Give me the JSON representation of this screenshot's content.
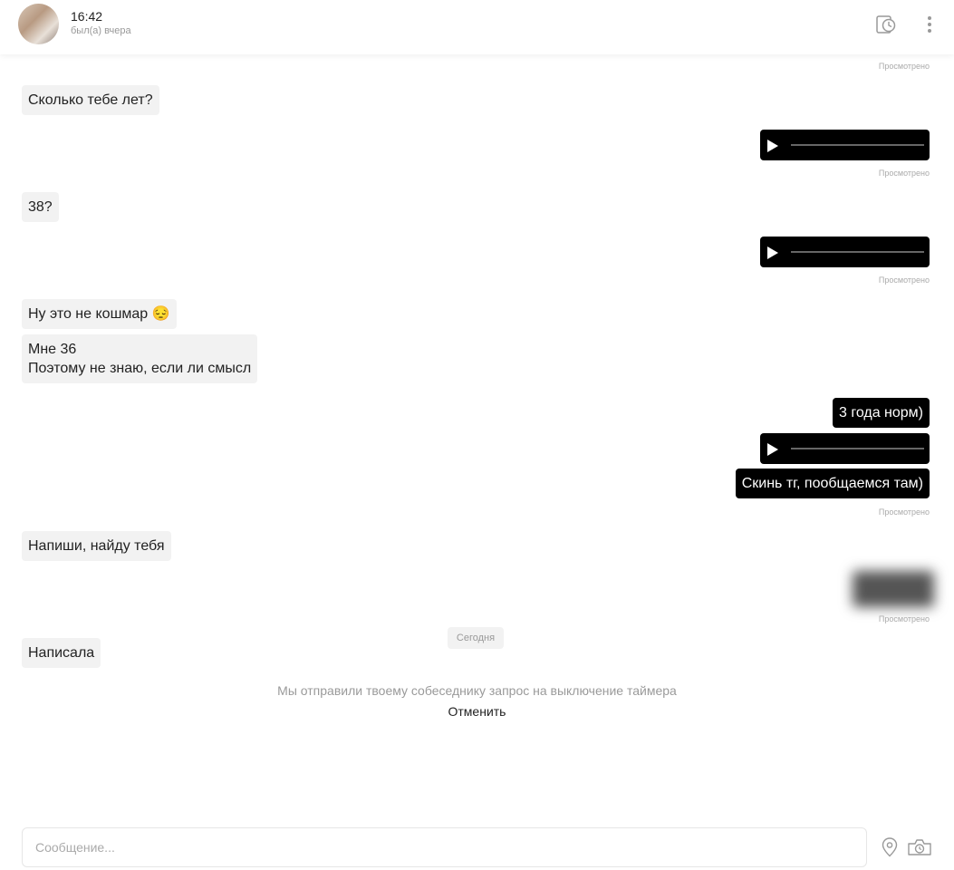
{
  "header": {
    "time": "16:42",
    "status": "был(а) вчера",
    "icons": [
      "timer-icon",
      "more-icon"
    ]
  },
  "messages": {
    "seen_label": "Просмотрено",
    "m1": "Сколько тебе лет?",
    "m2": "38?",
    "m3": "Ну это не кошмар 😔",
    "m4": "Мне 36\nПоэтому не знаю, если ли смысл",
    "m5": "3 года норм)",
    "m6": "Скинь тг, пообщаемся там)",
    "m7": "Напиши, найду тебя",
    "m8": "Написала"
  },
  "date_divider": "Сегодня",
  "system": {
    "note": "Мы отправили твоему собеседнику запрос на выключение таймера",
    "cancel_label": "Отменить"
  },
  "composer": {
    "placeholder": "Сообщение...",
    "icons": [
      "location-icon",
      "camera-icon"
    ]
  },
  "colors": {
    "outgoing": "#000000",
    "incoming": "#f2f2f2",
    "muted": "#aaaaaa"
  }
}
